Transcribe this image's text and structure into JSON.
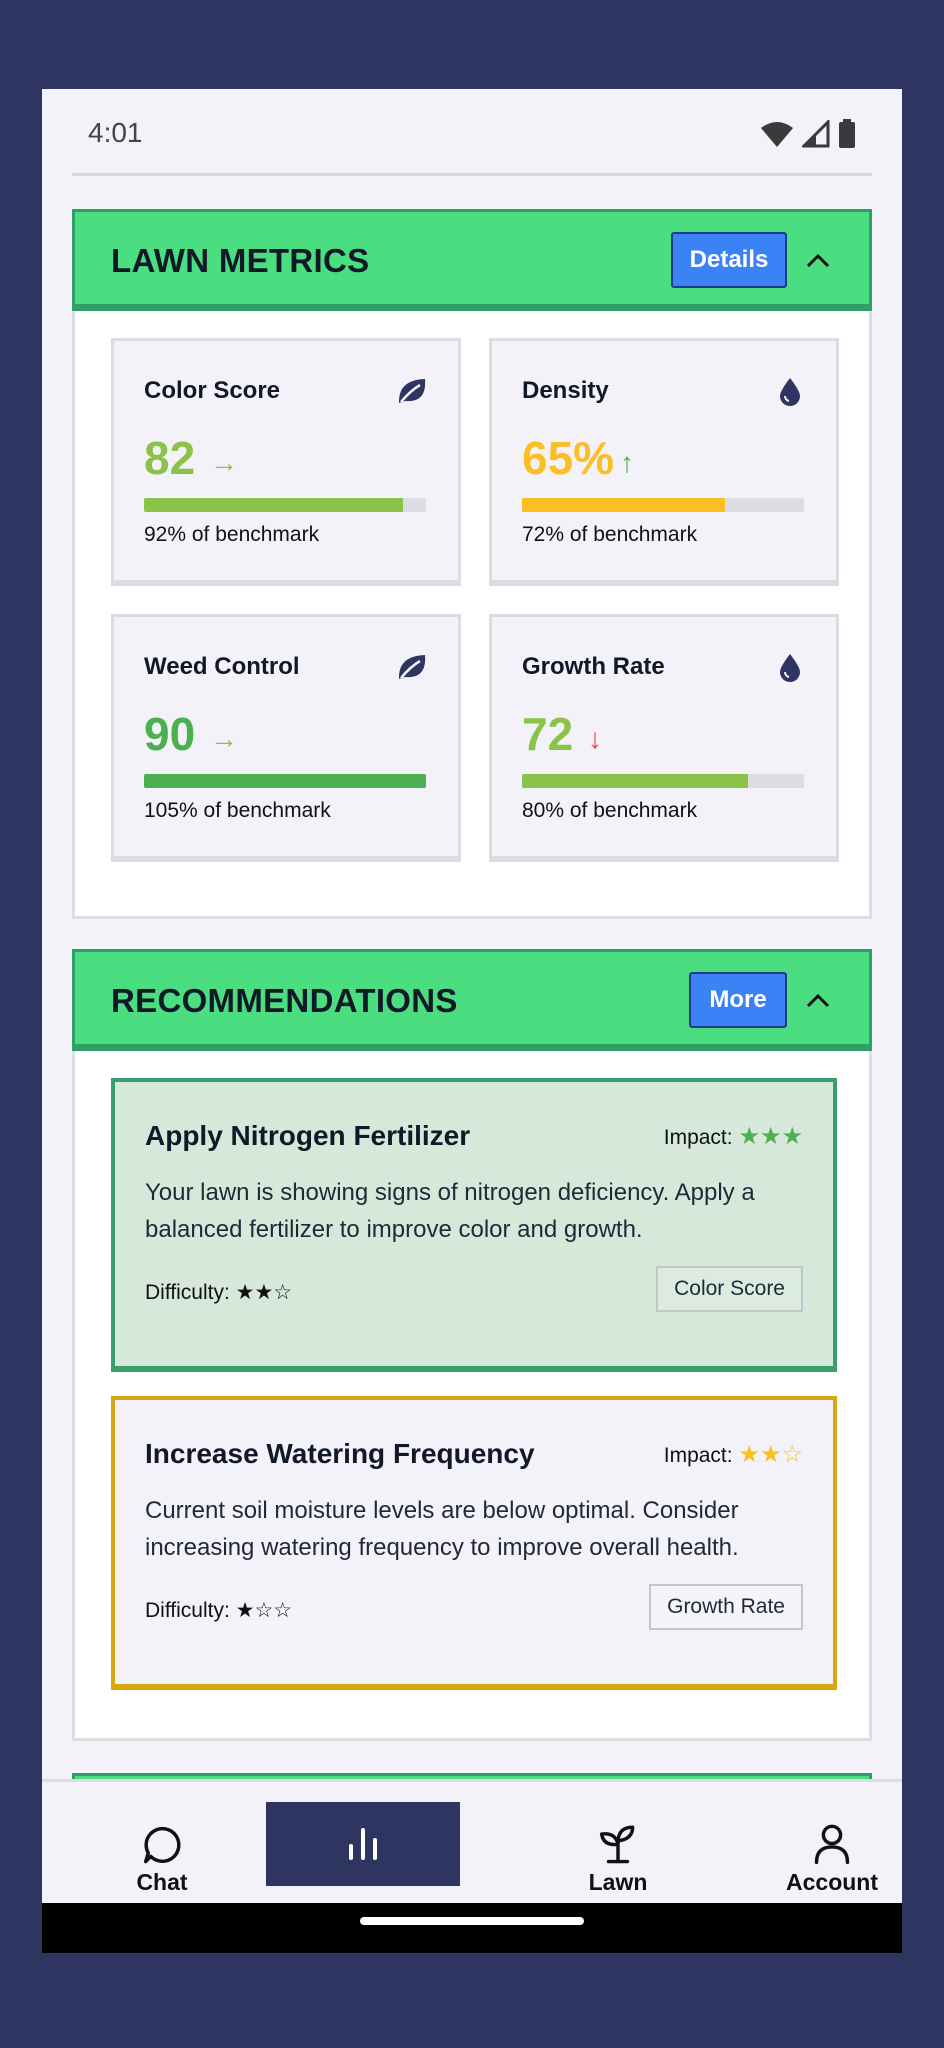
{
  "status": {
    "time": "4:01"
  },
  "lawn_metrics": {
    "title": "LAWN METRICS",
    "details_label": "Details",
    "cards": [
      {
        "name": "Color Score",
        "icon": "leaf-icon",
        "value": "82",
        "trend": "→",
        "trend_color": "#8bc34a",
        "value_color": "#8bc34a",
        "bar_fill_percent": 92,
        "bar_color": "#8bc34a",
        "benchmark": "92% of benchmark"
      },
      {
        "name": "Density",
        "icon": "water-drop-icon",
        "value": "65%",
        "trend": "↑",
        "trend_color": "#4caf50",
        "value_color": "#fbbf24",
        "bar_fill_percent": 72,
        "bar_color": "#fbbf24",
        "benchmark": "72% of benchmark"
      },
      {
        "name": "Weed Control",
        "icon": "leaf-icon",
        "value": "90",
        "trend": "→",
        "trend_color": "#8bc34a",
        "value_color": "#4caf50",
        "bar_fill_percent": 100,
        "bar_color": "#4caf50",
        "benchmark": "105% of benchmark"
      },
      {
        "name": "Growth Rate",
        "icon": "water-drop-icon",
        "value": "72",
        "trend": "↓",
        "trend_color": "#ef4444",
        "value_color": "#8bc34a",
        "bar_fill_percent": 80,
        "bar_color": "#8bc34a",
        "benchmark": "80% of benchmark"
      }
    ]
  },
  "recommendations": {
    "title": "RECOMMENDATIONS",
    "more_label": "More",
    "items": [
      {
        "title": "Apply Nitrogen Fertilizer",
        "impact_label": "Impact:",
        "impact_stars": "★★★",
        "impact_color": "#4caf50",
        "description": "Your lawn is showing signs of nitrogen deficiency. Apply a balanced fertilizer to improve color and growth.",
        "difficulty": "Difficulty: ★★☆",
        "tag": "Color Score",
        "border_color": "#3a9d6e",
        "bg_color": "#d5e8da"
      },
      {
        "title": "Increase Watering Frequency",
        "impact_label": "Impact:",
        "impact_stars": "★★☆",
        "impact_color": "#fbbf24",
        "description": "Current soil moisture levels are below optimal. Consider increasing watering frequency to improve overall health.",
        "difficulty": "Difficulty: ★☆☆",
        "tag": "Growth Rate",
        "border_color": "#d9a511",
        "bg_color": "#f3f2f8"
      }
    ]
  },
  "nav": {
    "chat": "Chat",
    "lawn": "Lawn",
    "account": "Account"
  },
  "colors": {
    "header_green": "#4ade80",
    "accent_blue": "#3b82f6",
    "navy": "#2e3561"
  }
}
